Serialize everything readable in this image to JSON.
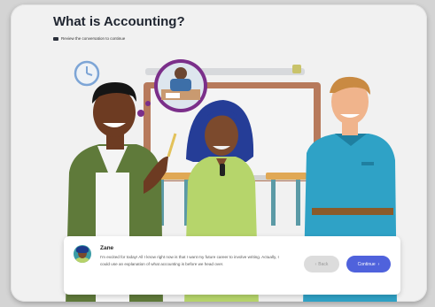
{
  "lesson": {
    "title": "What is Accounting?",
    "instruction": "Review the conversation to continue"
  },
  "dialog": {
    "speaker": "Zane",
    "message": "I'm excited for today! All I know right now is that I want my future career to involve writing. Actually, I could use an explanation of what accounting is before we head over.",
    "back_label": "Back",
    "continue_label": "Continue"
  },
  "icons": {
    "clock": "clock-icon",
    "back": "chevron-left-icon",
    "continue": "chevron-right-icon"
  },
  "colors": {
    "accent": "#4f62dc",
    "background": "#f1f1f1"
  }
}
